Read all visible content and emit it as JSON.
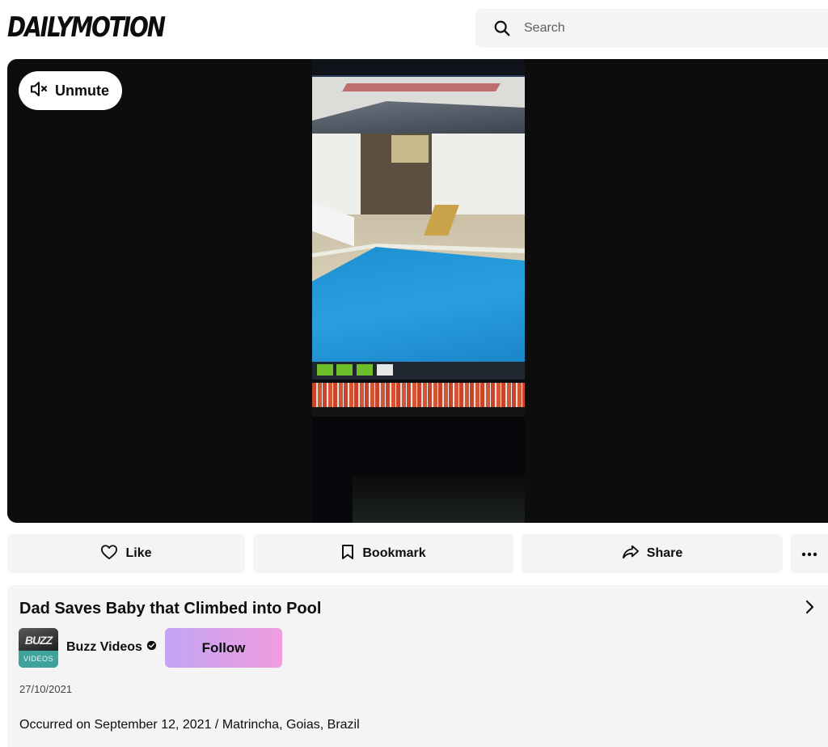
{
  "header": {
    "logo_text": "DAILYMOTION",
    "search": {
      "placeholder": "Search",
      "icon": "search-icon"
    }
  },
  "player": {
    "unmute": {
      "label": "Unmute",
      "icon": "speaker-muted-icon"
    }
  },
  "actions": {
    "like": {
      "label": "Like",
      "icon": "heart-icon"
    },
    "bookmark": {
      "label": "Bookmark",
      "icon": "bookmark-icon"
    },
    "share": {
      "label": "Share",
      "icon": "share-arrow-icon"
    },
    "more": {
      "icon": "more-dots-icon"
    }
  },
  "video": {
    "title": "Dad Saves Baby that Climbed into Pool",
    "channel": {
      "name": "Buzz Videos",
      "verified_icon": "verified-badge-icon",
      "avatar_top": "BUZZ",
      "avatar_bottom": "VIDEOS"
    },
    "follow_label": "Follow",
    "date": "27/10/2021",
    "description": "Occurred on September 12, 2021 / Matrincha, Goias, Brazil"
  },
  "colors": {
    "text": "#0d0d0d",
    "surface": "#f4f4f4",
    "player_bg": "#0d0d0d",
    "follow_gradient_start": "#c3a4f5",
    "follow_gradient_end": "#ef9dde"
  }
}
